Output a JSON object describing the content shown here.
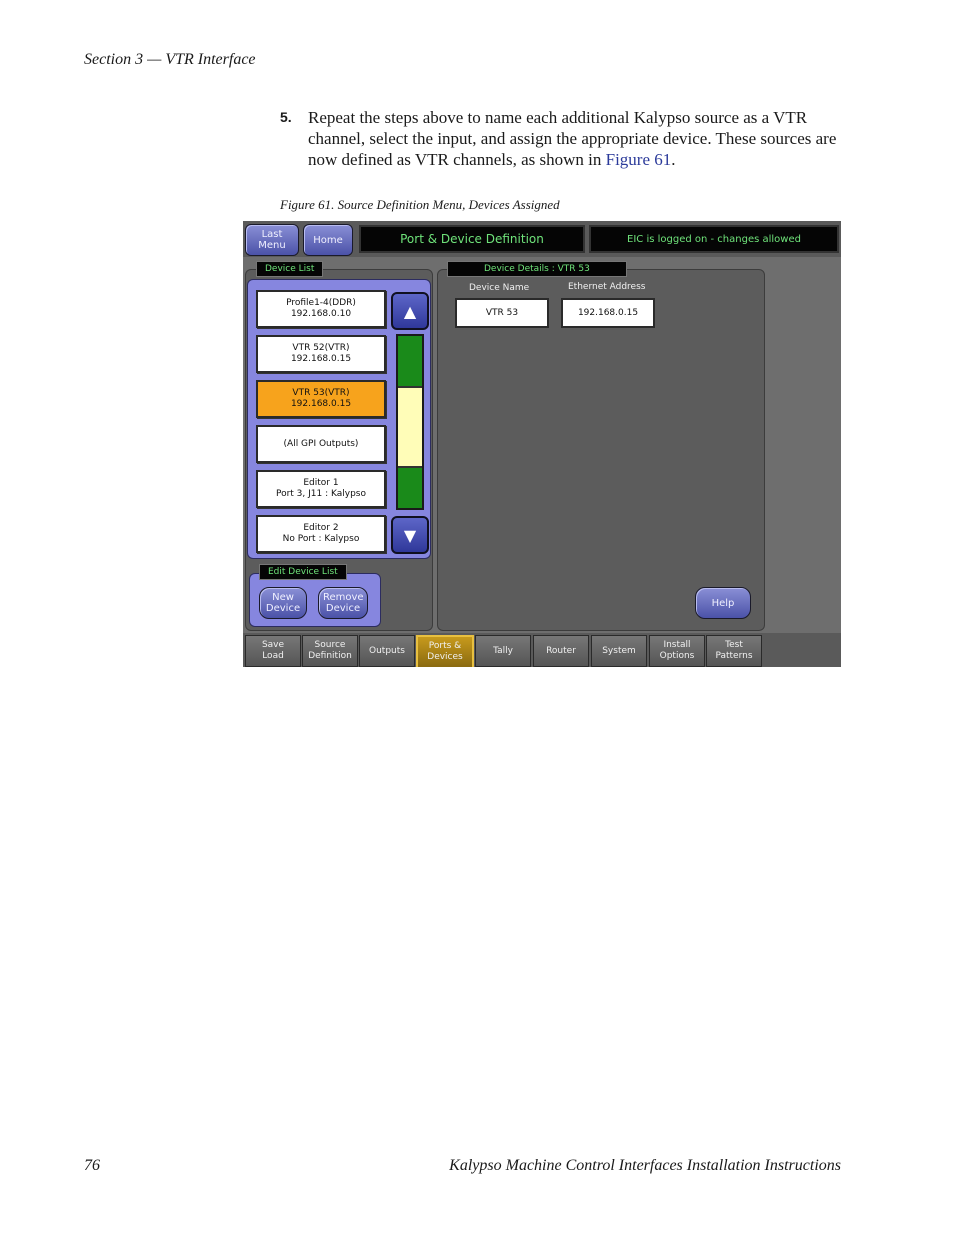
{
  "page": {
    "header": "Section 3 — VTR Interface",
    "step_number": "5.",
    "step_text": "Repeat the steps above to name each additional Kalypso source as a VTR channel, select the input, and assign the appropriate device. These sources are now defined as VTR channels, as shown in ",
    "step_link": "Figure 61",
    "step_end": ".",
    "caption": "Figure 61.  Source Definition Menu, Devices Assigned",
    "footer_page": "76",
    "footer_title": "Kalypso Machine Control Interfaces Installation Instructions"
  },
  "screen": {
    "last_menu": "Last Menu",
    "home": "Home",
    "title": "Port & Device Definition",
    "status": "EIC is logged on - changes allowed",
    "device_list_tag": "Device List",
    "devices": [
      {
        "line1": "Profile1-4(DDR)",
        "line2": "192.168.0.10",
        "selected": false
      },
      {
        "line1": "VTR 52(VTR)",
        "line2": "192.168.0.15",
        "selected": false
      },
      {
        "line1": "VTR 53(VTR)",
        "line2": "192.168.0.15",
        "selected": true
      },
      {
        "line1": "(All GPI Outputs)",
        "line2": "",
        "selected": false
      },
      {
        "line1": "Editor 1",
        "line2": "Port 3, J11 : Kalypso",
        "selected": false
      },
      {
        "line1": "Editor 2",
        "line2": "No Port : Kalypso",
        "selected": false
      }
    ],
    "edit_tag": "Edit Device List",
    "new_device": "New Device",
    "remove_device": "Remove Device",
    "details_tag": "Device Details : VTR 53",
    "device_name_label": "Device Name",
    "device_name_value": "VTR 53",
    "ethernet_label": "Ethernet Address",
    "ethernet_value": "192.168.0.15",
    "help": "Help",
    "tabs": [
      {
        "label": "Save Load",
        "active": false
      },
      {
        "label": "Source Definition",
        "active": false
      },
      {
        "label": "Outputs",
        "active": false
      },
      {
        "label": "Ports & Devices",
        "active": true
      },
      {
        "label": "Tally",
        "active": false
      },
      {
        "label": "Router",
        "active": false
      },
      {
        "label": "System",
        "active": false
      },
      {
        "label": "Install Options",
        "active": false
      },
      {
        "label": "Test Patterns",
        "active": false
      }
    ]
  }
}
